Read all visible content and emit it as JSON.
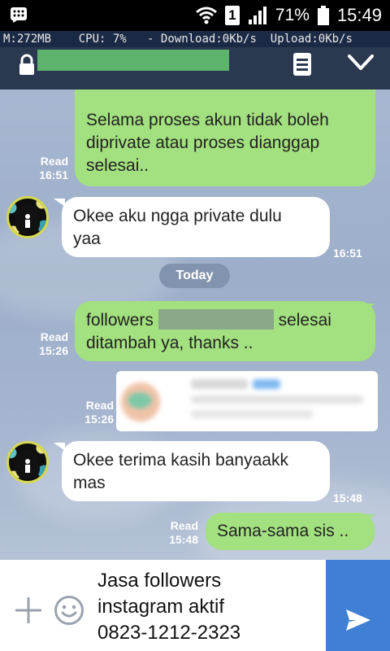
{
  "status_bar": {
    "battery_percent": "71%",
    "time": "15:49",
    "sim_badge": "1"
  },
  "monitor": {
    "memory": "M:272MB",
    "cpu": "CPU: 7%",
    "download": "- Download:0Kb/s",
    "upload": "Upload:0Kb/s"
  },
  "header": {
    "lock_icon": "lock-icon",
    "notes_icon": "notes-icon",
    "collapse_icon": "chevron-down-icon"
  },
  "messages": [
    {
      "direction": "out",
      "lines": [
        "Selama proses akun tidak boleh",
        "diprivate atau proses dianggap",
        "selesai.."
      ],
      "read_label": "Read",
      "time": "16:51"
    },
    {
      "direction": "in",
      "lines": [
        "Okee aku ngga private dulu",
        "yaa"
      ],
      "time": "16:51"
    },
    {
      "direction": "out",
      "line1_prefix": "followers",
      "line1_suffix": "selesai",
      "line2": "ditambah ya, thanks ..",
      "read_label": "Read",
      "time": "15:26"
    },
    {
      "direction": "out",
      "kind": "attachment",
      "read_label": "Read",
      "time": "15:26"
    },
    {
      "direction": "in",
      "lines": [
        "Okee terima kasih banyaakk",
        "mas"
      ],
      "time": "15:48"
    },
    {
      "direction": "out",
      "lines": [
        "Sama-sama sis .."
      ],
      "read_label": "Read",
      "time": "15:48"
    }
  ],
  "date_separator": "Today",
  "composer": {
    "lines": [
      "Jasa followers",
      "instagram aktif",
      "0823-1212-2323"
    ]
  },
  "colors": {
    "outgoing_bubble": "#a3e080",
    "incoming_bubble": "#ffffff",
    "header": "#2b3950",
    "send_button": "#3f7fd4"
  }
}
